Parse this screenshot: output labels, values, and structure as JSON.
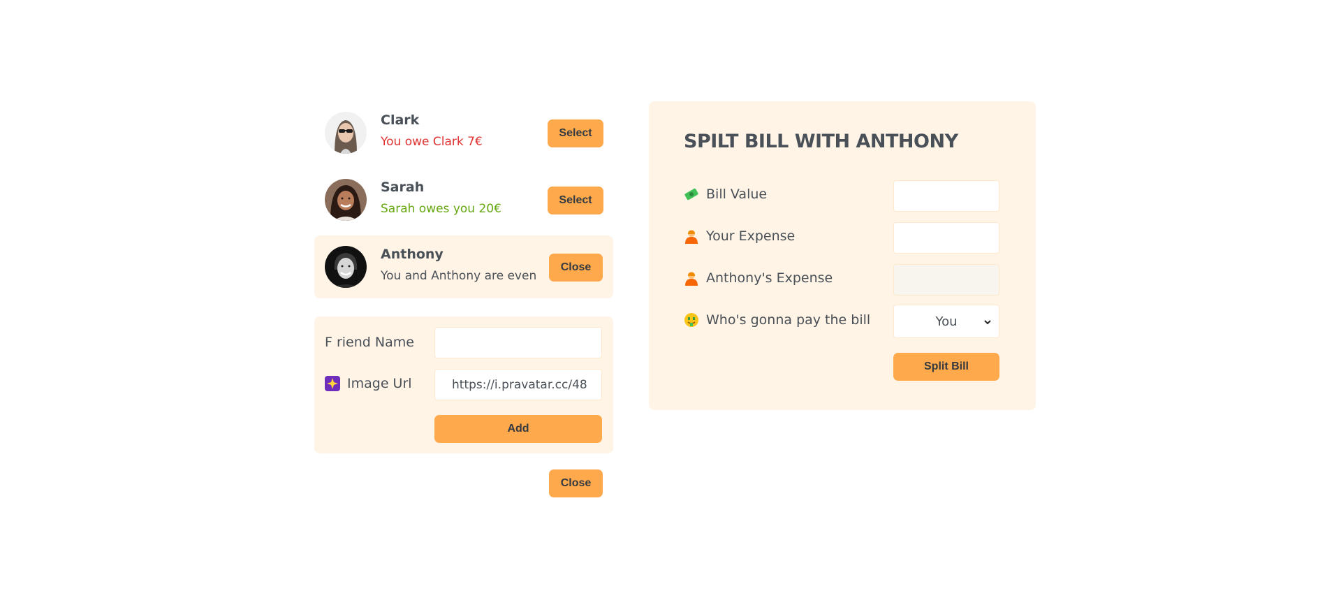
{
  "friends": [
    {
      "name": "Clark",
      "status": "You owe Clark 7€",
      "button": "Select"
    },
    {
      "name": "Sarah",
      "status": "Sarah owes you 20€",
      "button": "Select"
    },
    {
      "name": "Anthony",
      "status": "You and Anthony are even",
      "button": "Close"
    }
  ],
  "add_friend": {
    "name_label": "F riend Name",
    "name_value": "",
    "image_label": "Image Url",
    "image_value": "https://i.pravatar.cc/48",
    "add_button": "Add",
    "close_button": "Close"
  },
  "split": {
    "title": "SPILT BILL WITH ANTHONY",
    "bill_label": "Bill Value",
    "bill_value": "",
    "your_label": "Your Expense",
    "your_value": "",
    "friend_label": "Anthony's Expense",
    "friend_value": "",
    "payer_label": "Who's gonna pay the bill",
    "payer_selected": "You",
    "submit_button": "Split Bill"
  },
  "colors": {
    "accent": "#ffa94d",
    "panel": "#fff4e6",
    "owe": "#e03131",
    "owed": "#66a80f"
  },
  "icons": [
    "money-icon",
    "person-icon",
    "person-icon",
    "money-face-icon",
    "sparkle-icon"
  ]
}
